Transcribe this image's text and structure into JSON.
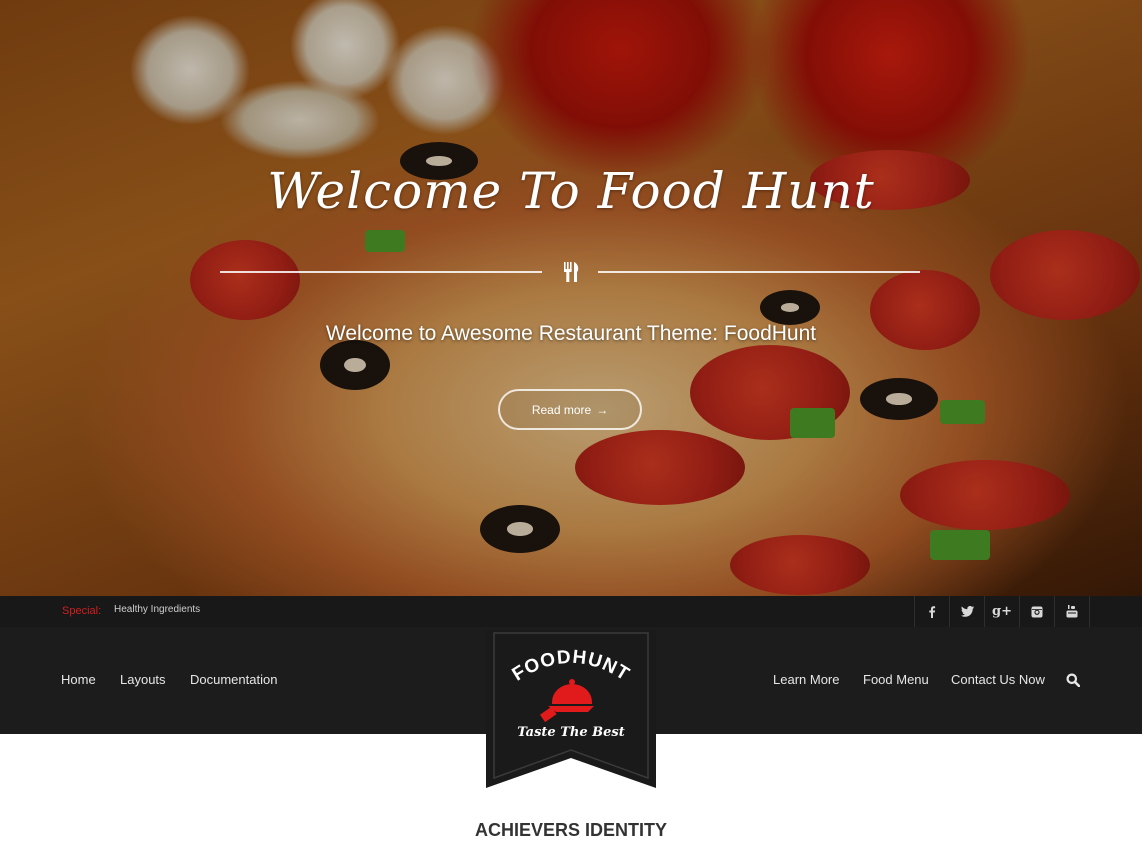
{
  "hero": {
    "title": "Welcome To Food Hunt",
    "subtitle": "Welcome to Awesome Restaurant Theme: FoodHunt",
    "read_more_label": "Read more",
    "read_more_arrow": "→",
    "divider_icon": "fork-knife-icon"
  },
  "topbar": {
    "special_label": "Special:",
    "special_text": "Healthy Ingredients",
    "social": [
      {
        "name": "facebook",
        "glyph": "f"
      },
      {
        "name": "twitter",
        "glyph": "t"
      },
      {
        "name": "google-plus",
        "glyph": "g+"
      },
      {
        "name": "instagram",
        "glyph": "ig"
      },
      {
        "name": "youtube",
        "glyph": "yt"
      }
    ]
  },
  "nav": {
    "left": [
      "Home",
      "Layouts",
      "Documentation"
    ],
    "right": [
      "Learn More",
      "Food Menu",
      "Contact Us Now"
    ],
    "search_icon": "search-icon"
  },
  "logo": {
    "brand": "FOODHUNT",
    "tagline": "Taste The Best"
  },
  "section": {
    "title": "ACHIEVERS IDENTITY"
  },
  "colors": {
    "accent_red": "#d21f1f",
    "nav_bg": "#1c1c1c",
    "topbar_bg": "#181818"
  }
}
